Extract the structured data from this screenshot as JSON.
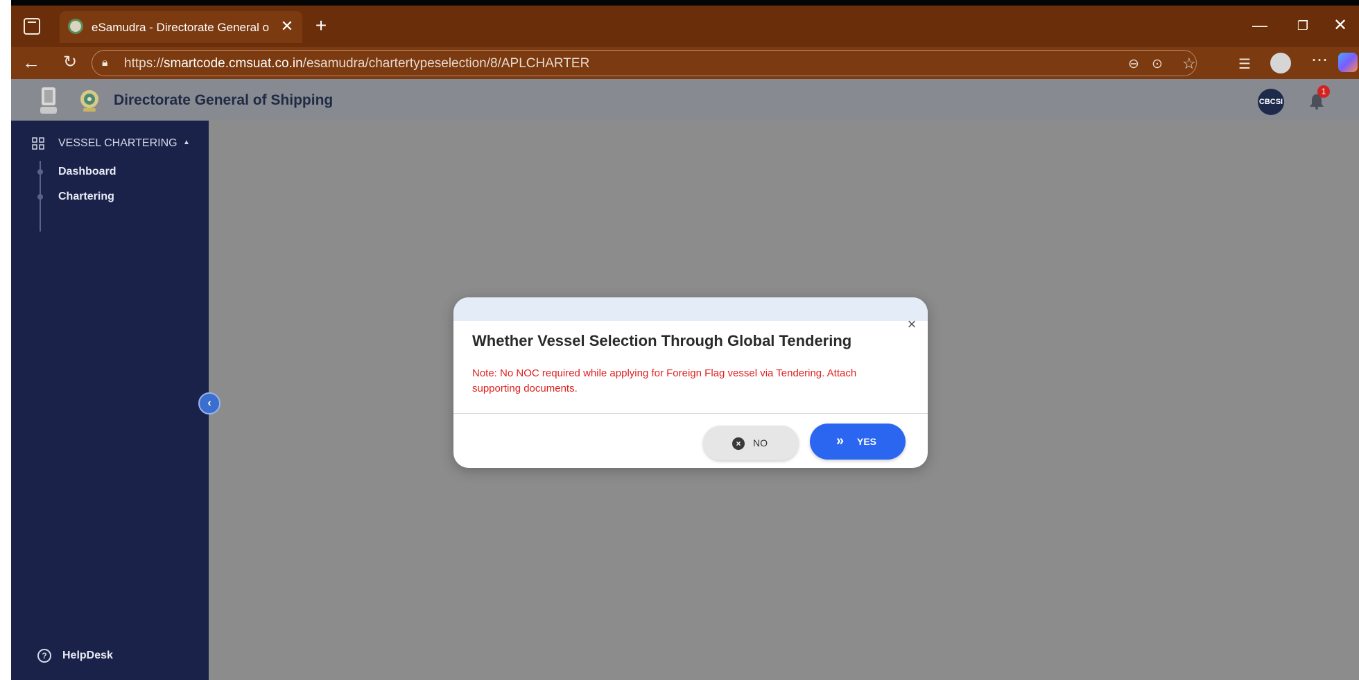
{
  "browser": {
    "tab_title": "eSamudra - Directorate General o",
    "tab_close": "✕",
    "new_tab": "+",
    "url_scheme": "https://",
    "url_host": "smartcode.cmsuat.co.in",
    "url_path": "/esamudra/chartertypeselection/8/APLCHARTER",
    "controls": {
      "minimize": "—",
      "restore": "❐",
      "close": "✕"
    }
  },
  "app": {
    "title": "Directorate General of Shipping",
    "avatar_text": "CBCSI",
    "notification_count": "1"
  },
  "sidebar": {
    "section_label": "VESSEL CHARTERING",
    "items": [
      {
        "label": "Dashboard"
      },
      {
        "label": "Chartering"
      }
    ],
    "helpdesk_label": "HelpDesk"
  },
  "modal": {
    "title": "Whether Vessel Selection Through Global Tendering",
    "note": "Note: No NOC required while applying for Foreign Flag vessel via Tendering. Attach supporting documents.",
    "no_label": "NO",
    "yes_label": "YES"
  },
  "colors": {
    "titlebar": "#6a2f0a",
    "sidebar": "#1a2249",
    "primary": "#2a66f0",
    "note": "#e01f1f"
  }
}
